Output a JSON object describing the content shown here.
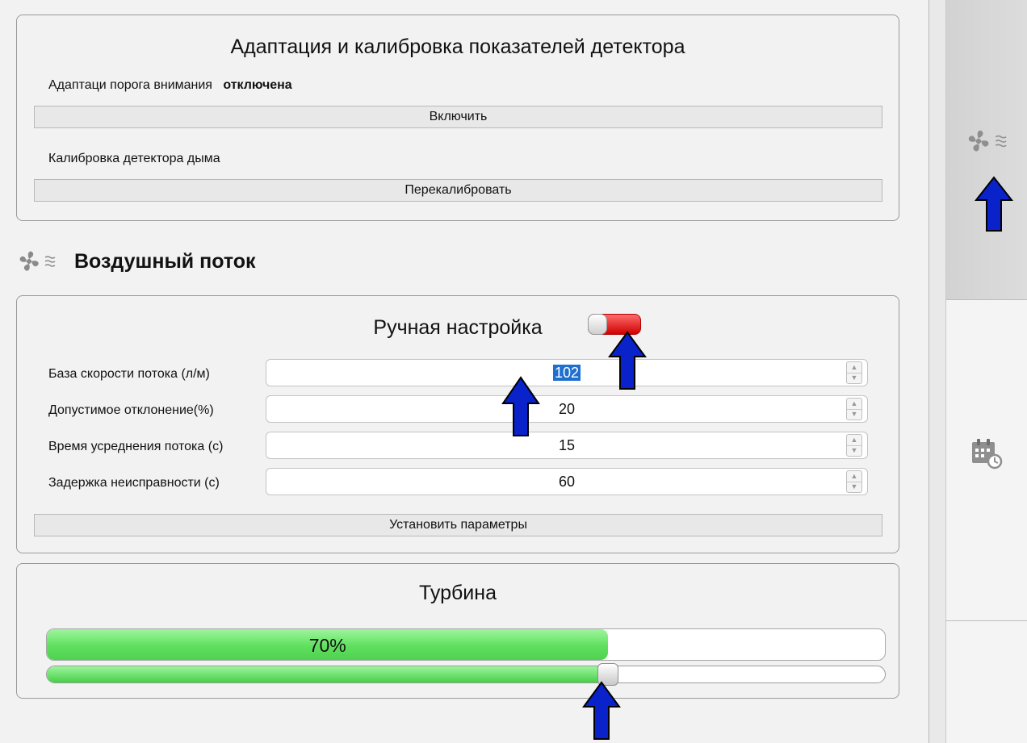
{
  "calibration": {
    "title": "Адаптация и калибровка показателей детектора",
    "adaptation_label": "Адаптаци порога внимания",
    "adaptation_status": "отключена",
    "enable_button": "Включить",
    "smoke_label": "Калибровка детектора дыма",
    "recalibrate_button": "Перекалибровать"
  },
  "airflow": {
    "section_title": "Воздушный поток",
    "icon": "fan-airflow-icon"
  },
  "manual": {
    "title": "Ручная настройка",
    "toggle_state": "off",
    "fields": [
      {
        "label": "База скорости потока (л/м)",
        "value": "102"
      },
      {
        "label": "Допустимое отклонение(%)",
        "value": "20"
      },
      {
        "label": "Время усреднения потока (с)",
        "value": "15"
      },
      {
        "label": "Задержка неисправности (с)",
        "value": "60"
      }
    ],
    "apply_button": "Установить параметры"
  },
  "turbine": {
    "title": "Турбина",
    "progress_text": "70%",
    "progress_value": 0.67,
    "slider_value": 0.67
  },
  "sidebar": {
    "tabs": [
      {
        "icon": "fan-airflow-icon",
        "active": true
      },
      {
        "icon": "calendar-clock-icon",
        "active": false
      }
    ]
  },
  "colors": {
    "accent_green": "#5fe05f",
    "toggle_red": "#e00000",
    "arrow_blue": "#0a22c9"
  }
}
